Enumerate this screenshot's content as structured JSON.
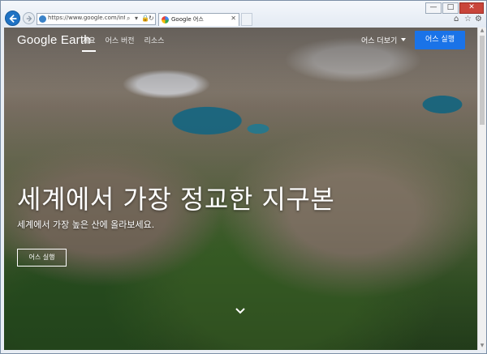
{
  "browser": {
    "url": "https://www.google.com/intl/ko/earth",
    "tab_title": "Google 어스",
    "window_controls": [
      "—",
      "□",
      "✕"
    ]
  },
  "header": {
    "logo": "Google Earth",
    "nav": [
      {
        "label": "개요",
        "active": true
      },
      {
        "label": "어스 버전",
        "active": false
      },
      {
        "label": "리소스",
        "active": false
      }
    ],
    "more_label": "어스 더보기",
    "launch_label": "어스 실행"
  },
  "hero": {
    "title": "세계에서 가장 정교한 지구본",
    "subtitle": "세계에서 가장 높은 산에 올라보세요.",
    "button_label": "어스 실행"
  },
  "colors": {
    "accent": "#1a73e8",
    "back_button": "#1f72c4"
  }
}
